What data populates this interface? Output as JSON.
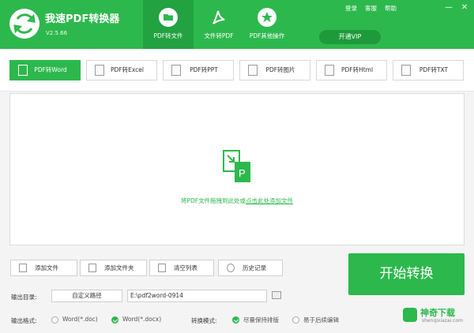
{
  "app": {
    "name": "我速PDF转换器",
    "version": "V2.5.66"
  },
  "nav_tabs": [
    {
      "label": "PDF转文件",
      "icon": "folder-icon",
      "active": true
    },
    {
      "label": "文件转PDF",
      "icon": "pdf-icon",
      "active": false
    },
    {
      "label": "PDF其他操作",
      "icon": "star-icon",
      "active": false
    }
  ],
  "top_menu": {
    "login": "登录",
    "account": "客服",
    "help": "帮助"
  },
  "window": {
    "minimize": "—",
    "close": "✕"
  },
  "vip_button": "开通VIP",
  "convert_tabs": [
    {
      "label": "PDF转Word",
      "active": true
    },
    {
      "label": "PDF转Excel",
      "active": false
    },
    {
      "label": "PDF转PPT",
      "active": false
    },
    {
      "label": "PDF转图片",
      "active": false
    },
    {
      "label": "PDF转Html",
      "active": false
    },
    {
      "label": "PDF转TXT",
      "active": false
    }
  ],
  "drop_area": {
    "text_prefix": "将PDF文件拖拽到此处或",
    "link": "点击此处添加文件"
  },
  "actions": {
    "add_file": "添加文件",
    "add_folder": "添加文件夹",
    "clear_list": "清空列表",
    "history": "历史记录"
  },
  "start_button": "开始转换",
  "output": {
    "dir_label": "输出目录:",
    "dir_mode": "自定义路径",
    "dir_path": "E:\\pdf2word-0914",
    "format_label": "输出格式:",
    "formats": [
      {
        "label": "Word(*.doc)",
        "checked": false
      },
      {
        "label": "Word(*.docx)",
        "checked": true
      }
    ],
    "mode_label": "转换模式:",
    "modes": [
      {
        "label": "尽量保持排版",
        "checked": true
      },
      {
        "label": "易于后续编辑",
        "checked": false
      }
    ]
  },
  "watermark": {
    "text": "神奇下载",
    "url": "shenqixiazai.com"
  },
  "colors": {
    "primary": "#2db84d",
    "primary_dark": "#22a240"
  }
}
